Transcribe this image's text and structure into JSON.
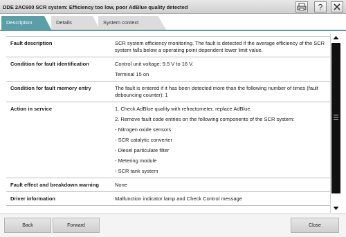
{
  "window": {
    "title": "DDE 2AC600 SCR system: Efficiency too low, poor AdBlue quality detected",
    "icons": [
      "print-icon",
      "help-icon",
      "close-icon"
    ],
    "help_glyph": "?"
  },
  "tabs": [
    {
      "label": "Description",
      "active": true
    },
    {
      "label": "Details",
      "active": false
    },
    {
      "label": "System context",
      "active": false
    }
  ],
  "colors": {
    "accent": "#5a9ea8",
    "scroll_thumb": "#111111"
  },
  "rows": [
    {
      "label": "Fault description",
      "values": [
        "SCR system efficiency monitoring. The fault is detected if the average efficiency of the SCR system falls below a operating point dependent lower limit value."
      ]
    },
    {
      "label": "Condition for fault identification",
      "values": [
        "Control unit voltage: 9.5 V to 16 V.",
        "Terminal 15 on"
      ]
    },
    {
      "label": "Condition for fault memory entry",
      "values": [
        "The fault is entered if it has been detected more than the following number of times (fault debouncing counter): 1"
      ]
    },
    {
      "label": "Action in service",
      "values": [
        "1. Check AdBlue quality with refractometer, replace AdBlue.",
        "2. Remove fault code entries on the following components of the SCR system:",
        "- Nitrogen oxide sensors",
        "- SCR catalytic converter",
        "- Diesel particulate filter",
        "- Metering module",
        "- SCR tank system"
      ]
    },
    {
      "label": "Fault effect and breakdown warning",
      "values": [
        "None"
      ]
    },
    {
      "label": "Driver information",
      "values": [
        "Malfunction indicator lamp and Check Control message"
      ]
    }
  ],
  "footer": {
    "back": "Back",
    "forward": "Forward",
    "close": "Close"
  }
}
